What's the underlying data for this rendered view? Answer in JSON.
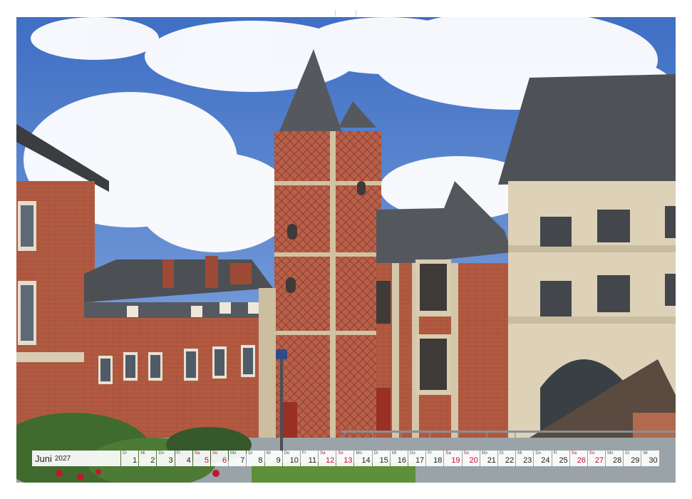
{
  "calendar": {
    "month": "Juni",
    "year": "2027",
    "days": [
      {
        "wd": "Di",
        "n": "1",
        "we": false
      },
      {
        "wd": "Mi",
        "n": "2",
        "we": false
      },
      {
        "wd": "Do",
        "n": "3",
        "we": false
      },
      {
        "wd": "Fr",
        "n": "4",
        "we": false
      },
      {
        "wd": "Sa",
        "n": "5",
        "we": true
      },
      {
        "wd": "So",
        "n": "6",
        "we": true
      },
      {
        "wd": "Mo",
        "n": "7",
        "we": false
      },
      {
        "wd": "Di",
        "n": "8",
        "we": false
      },
      {
        "wd": "Mi",
        "n": "9",
        "we": false
      },
      {
        "wd": "Do",
        "n": "10",
        "we": false
      },
      {
        "wd": "Fr",
        "n": "11",
        "we": false
      },
      {
        "wd": "Sa",
        "n": "12",
        "we": true
      },
      {
        "wd": "So",
        "n": "13",
        "we": true
      },
      {
        "wd": "Mo",
        "n": "14",
        "we": false
      },
      {
        "wd": "Di",
        "n": "15",
        "we": false
      },
      {
        "wd": "Mi",
        "n": "16",
        "we": false
      },
      {
        "wd": "Do",
        "n": "17",
        "we": false
      },
      {
        "wd": "Fr",
        "n": "18",
        "we": false
      },
      {
        "wd": "Sa",
        "n": "19",
        "we": true
      },
      {
        "wd": "So",
        "n": "20",
        "we": true
      },
      {
        "wd": "Mo",
        "n": "21",
        "we": false
      },
      {
        "wd": "Di",
        "n": "22",
        "we": false
      },
      {
        "wd": "Mi",
        "n": "23",
        "we": false
      },
      {
        "wd": "Do",
        "n": "24",
        "we": false
      },
      {
        "wd": "Fr",
        "n": "25",
        "we": false
      },
      {
        "wd": "Sa",
        "n": "26",
        "we": true
      },
      {
        "wd": "So",
        "n": "27",
        "we": true
      },
      {
        "wd": "Mo",
        "n": "28",
        "we": false
      },
      {
        "wd": "Di",
        "n": "29",
        "we": false
      },
      {
        "wd": "Mi",
        "n": "30",
        "we": false
      }
    ]
  },
  "colors": {
    "sky": "#5b86cf",
    "brick": "#b0533c",
    "stone": "#d9cdb4",
    "roof": "#4e5257",
    "weekend": "#c8102e"
  }
}
